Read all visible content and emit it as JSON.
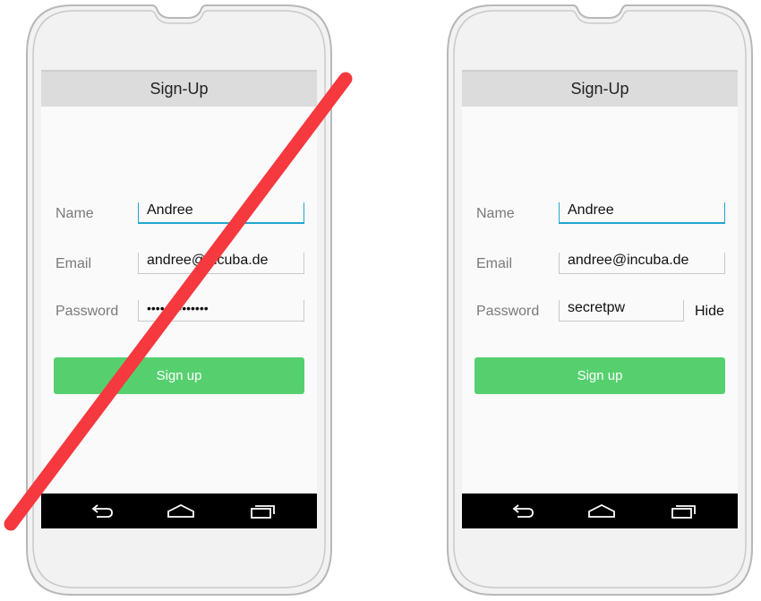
{
  "colors": {
    "appbar": "#dcdcdc",
    "signup_button": "#56d06e",
    "focus_underline": "#23a6cf",
    "strike_line": "#f5393f",
    "navbar": "#000000"
  },
  "left_phone": {
    "crossed_out": true,
    "title": "Sign-Up",
    "labels": {
      "name": "Name",
      "email": "Email",
      "password": "Password"
    },
    "values": {
      "name": "Andree",
      "email": "andree@incuba.de",
      "password_masked": "••••••••••••••"
    },
    "signup_label": "Sign up",
    "nav_icons": [
      "back-icon",
      "home-icon",
      "recents-icon"
    ]
  },
  "right_phone": {
    "crossed_out": false,
    "title": "Sign-Up",
    "labels": {
      "name": "Name",
      "email": "Email",
      "password": "Password"
    },
    "values": {
      "name": "Andree",
      "email": "andree@incuba.de",
      "password": "secretpw"
    },
    "toggle_label": "Hide",
    "signup_label": "Sign up",
    "nav_icons": [
      "back-icon",
      "home-icon",
      "recents-icon"
    ]
  }
}
